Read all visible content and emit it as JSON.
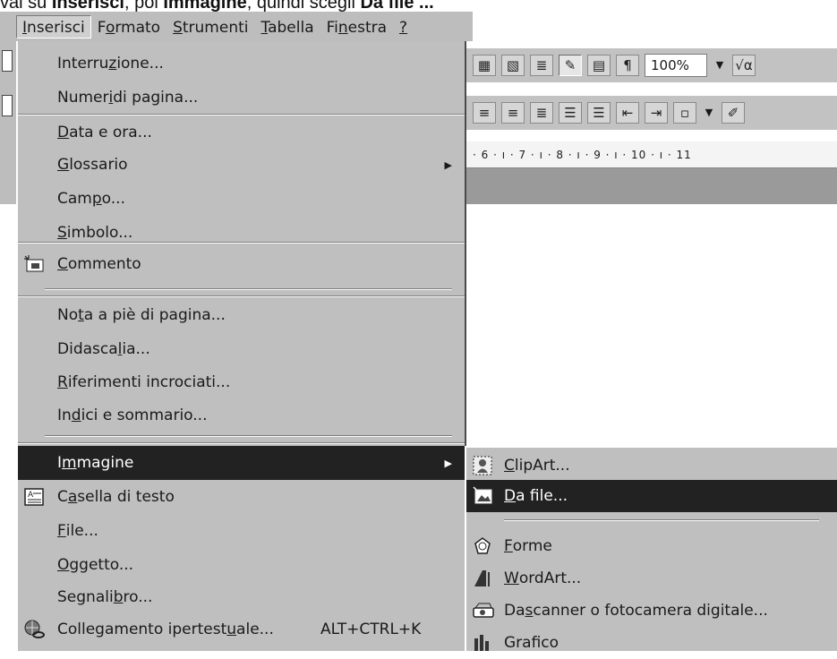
{
  "caption": {
    "lead": "vai su ",
    "b1": "Inserisci",
    "mid": ", poi ",
    "b2": "Immagine",
    "mid2": ", quindi scegli ",
    "b3": "Da file ..."
  },
  "menubar": [
    {
      "id": "inserisci",
      "pre": "",
      "ul": "I",
      "post": "nserisci"
    },
    {
      "id": "formato",
      "pre": "F",
      "ul": "o",
      "post": "rmato"
    },
    {
      "id": "strumenti",
      "pre": "",
      "ul": "S",
      "post": "trumenti"
    },
    {
      "id": "tabella",
      "pre": "",
      "ul": "T",
      "post": "abella"
    },
    {
      "id": "finestra",
      "pre": "Fi",
      "ul": "n",
      "post": "estra"
    },
    {
      "id": "help",
      "pre": "",
      "ul": "?",
      "post": ""
    }
  ],
  "toolbar": {
    "zoom": "100%",
    "pilcrow": "¶",
    "sqrt": "√α"
  },
  "ruler": "· 6 · ı · 7 · ı · 8 · ı · 9 · ı · 10 · ı · 11",
  "insert_menu": [
    {
      "pre": "Interru",
      "ul": "z",
      "post": "ione..."
    },
    {
      "pre": "Numer",
      "ul": "i",
      "post": " di pagina..."
    },
    {
      "pre": "",
      "ul": "D",
      "post": "ata e ora..."
    },
    {
      "pre": "",
      "ul": "G",
      "post": "lossario"
    },
    {
      "pre": "Cam",
      "ul": "p",
      "post": "o..."
    },
    {
      "pre": "",
      "ul": "S",
      "post": "imbolo..."
    },
    {
      "pre": "",
      "ul": "C",
      "post": "ommento"
    },
    {
      "pre": "No",
      "ul": "t",
      "post": "a a piè di pagina..."
    },
    {
      "pre": "Didasca",
      "ul": "l",
      "post": "ia..."
    },
    {
      "pre": "",
      "ul": "R",
      "post": "iferimenti incrociati..."
    },
    {
      "pre": "In",
      "ul": "d",
      "post": "ici e sommario..."
    },
    {
      "pre": "I",
      "ul": "m",
      "post": "magine"
    },
    {
      "pre": "C",
      "ul": "a",
      "post": "sella di testo"
    },
    {
      "pre": "",
      "ul": "F",
      "post": "ile..."
    },
    {
      "pre": "",
      "ul": "O",
      "post": "ggetto..."
    },
    {
      "pre": "Segnali",
      "ul": "b",
      "post": "ro..."
    },
    {
      "pre": "Collegamento ipertest",
      "ul": "u",
      "post": "ale...",
      "shortcut": "ALT+CTRL+K"
    }
  ],
  "image_submenu": [
    {
      "pre": "",
      "ul": "C",
      "post": "lipArt..."
    },
    {
      "pre": "",
      "ul": "D",
      "post": "a file..."
    },
    {
      "pre": "",
      "ul": "F",
      "post": "orme"
    },
    {
      "pre": "",
      "ul": "W",
      "post": "ordArt..."
    },
    {
      "pre": "Da ",
      "ul": "s",
      "post": "canner o fotocamera digitale..."
    },
    {
      "pre": "",
      "ul": "",
      "post": "Grafico"
    }
  ]
}
